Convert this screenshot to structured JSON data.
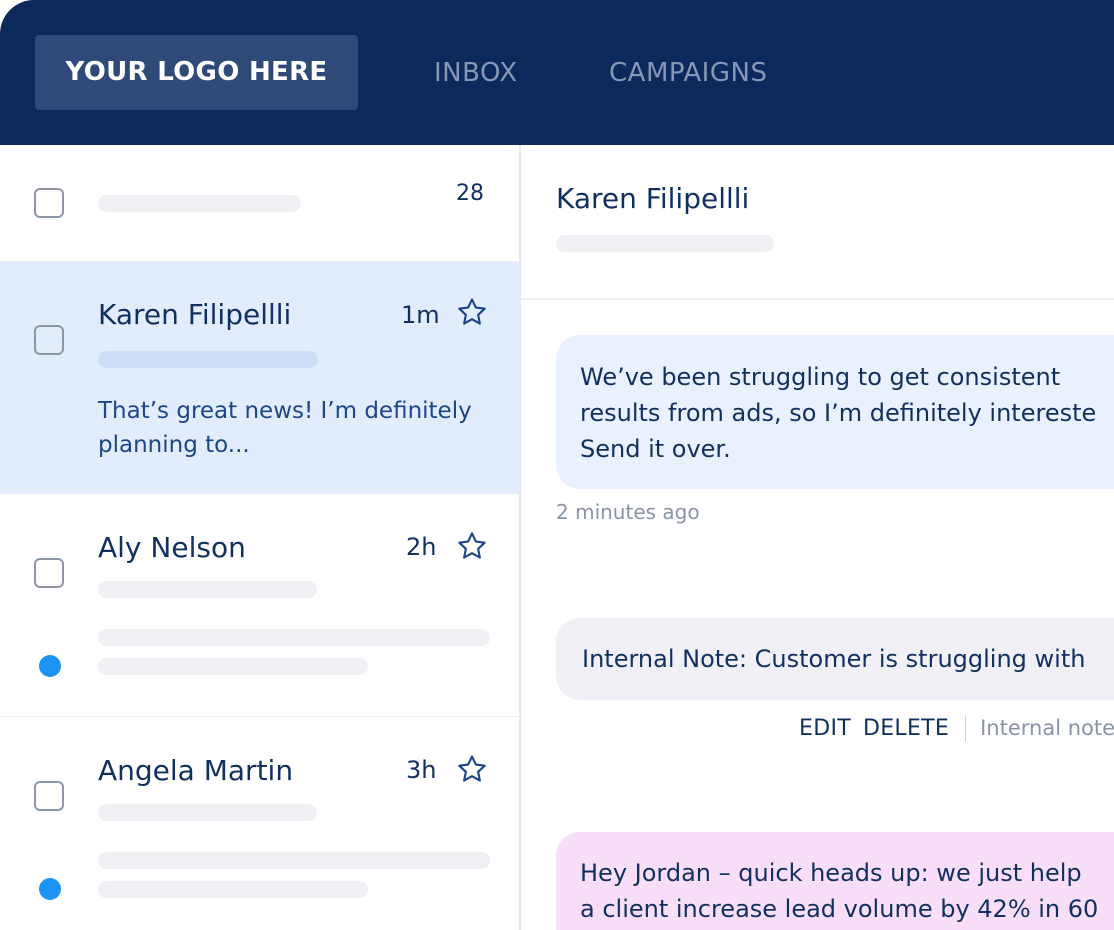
{
  "header": {
    "logo": "YOUR LOGO HERE",
    "tabs": [
      {
        "label": "INBOX"
      },
      {
        "label": "CAMPAIGNS"
      }
    ]
  },
  "sidebar": {
    "count": "28",
    "conversations": [
      {
        "name": "Karen Filipellli",
        "time": "1m",
        "snippet_line1": "That’s great news! I’m definitely",
        "snippet_line2": "planning to...",
        "selected": true
      },
      {
        "name": "Aly Nelson",
        "time": "2h",
        "unread": true
      },
      {
        "name": "Angela Martin",
        "time": "3h",
        "unread": true
      }
    ]
  },
  "conversation": {
    "contact_name": "Karen Filipellli",
    "messages": [
      {
        "type": "incoming",
        "lines": [
          "We’ve been struggling to get consistent",
          "results from ads, so I’m definitely intereste",
          "Send it over."
        ],
        "timestamp": "2 minutes ago"
      },
      {
        "type": "internal-note",
        "text": "Internal Note: Customer is struggling with",
        "actions": [
          "EDIT",
          "DELETE"
        ],
        "label": "Internal note"
      },
      {
        "type": "outgoing",
        "lines": [
          "Hey Jordan – quick heads up: we just help",
          "a client increase lead volume by 42% in 60"
        ]
      }
    ]
  },
  "colors": {
    "header_bg": "#0b2a5b",
    "selected_row_bg": "#e1edfd",
    "unread_dot": "#1d94f5",
    "incoming_bubble": "#e8f1fd",
    "note_bubble": "#f0f0f6",
    "outgoing_bubble": "#f8def8"
  }
}
